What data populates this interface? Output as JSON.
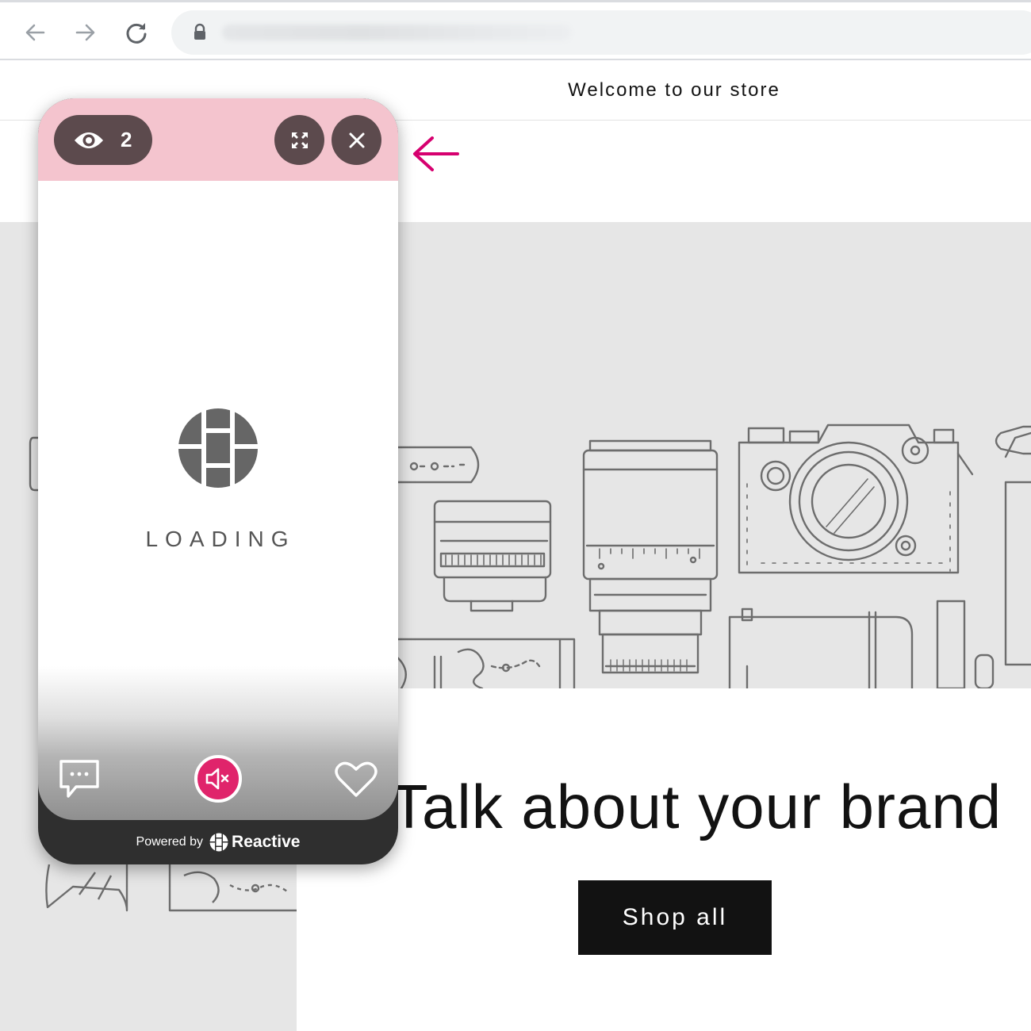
{
  "browser": {
    "url": ""
  },
  "store": {
    "announcement": "Welcome to our store",
    "heading": "Talk about your brand",
    "shop_button": "Shop all"
  },
  "widget": {
    "viewer_count": "2",
    "loading_text": "LOADING",
    "powered_label": "Powered by",
    "brand_name": "Reactive",
    "icons": [
      "eye-icon",
      "expand-icon",
      "close-icon",
      "chat-icon",
      "mute-icon",
      "heart-icon",
      "reactive-logo-icon"
    ]
  },
  "colors": {
    "widget_header": "#f4c4ce",
    "pill": "#5c4a4d",
    "mute_accent": "#e0246b",
    "arrow": "#d6006f",
    "footer": "#2f2f2f",
    "button": "#121212"
  }
}
